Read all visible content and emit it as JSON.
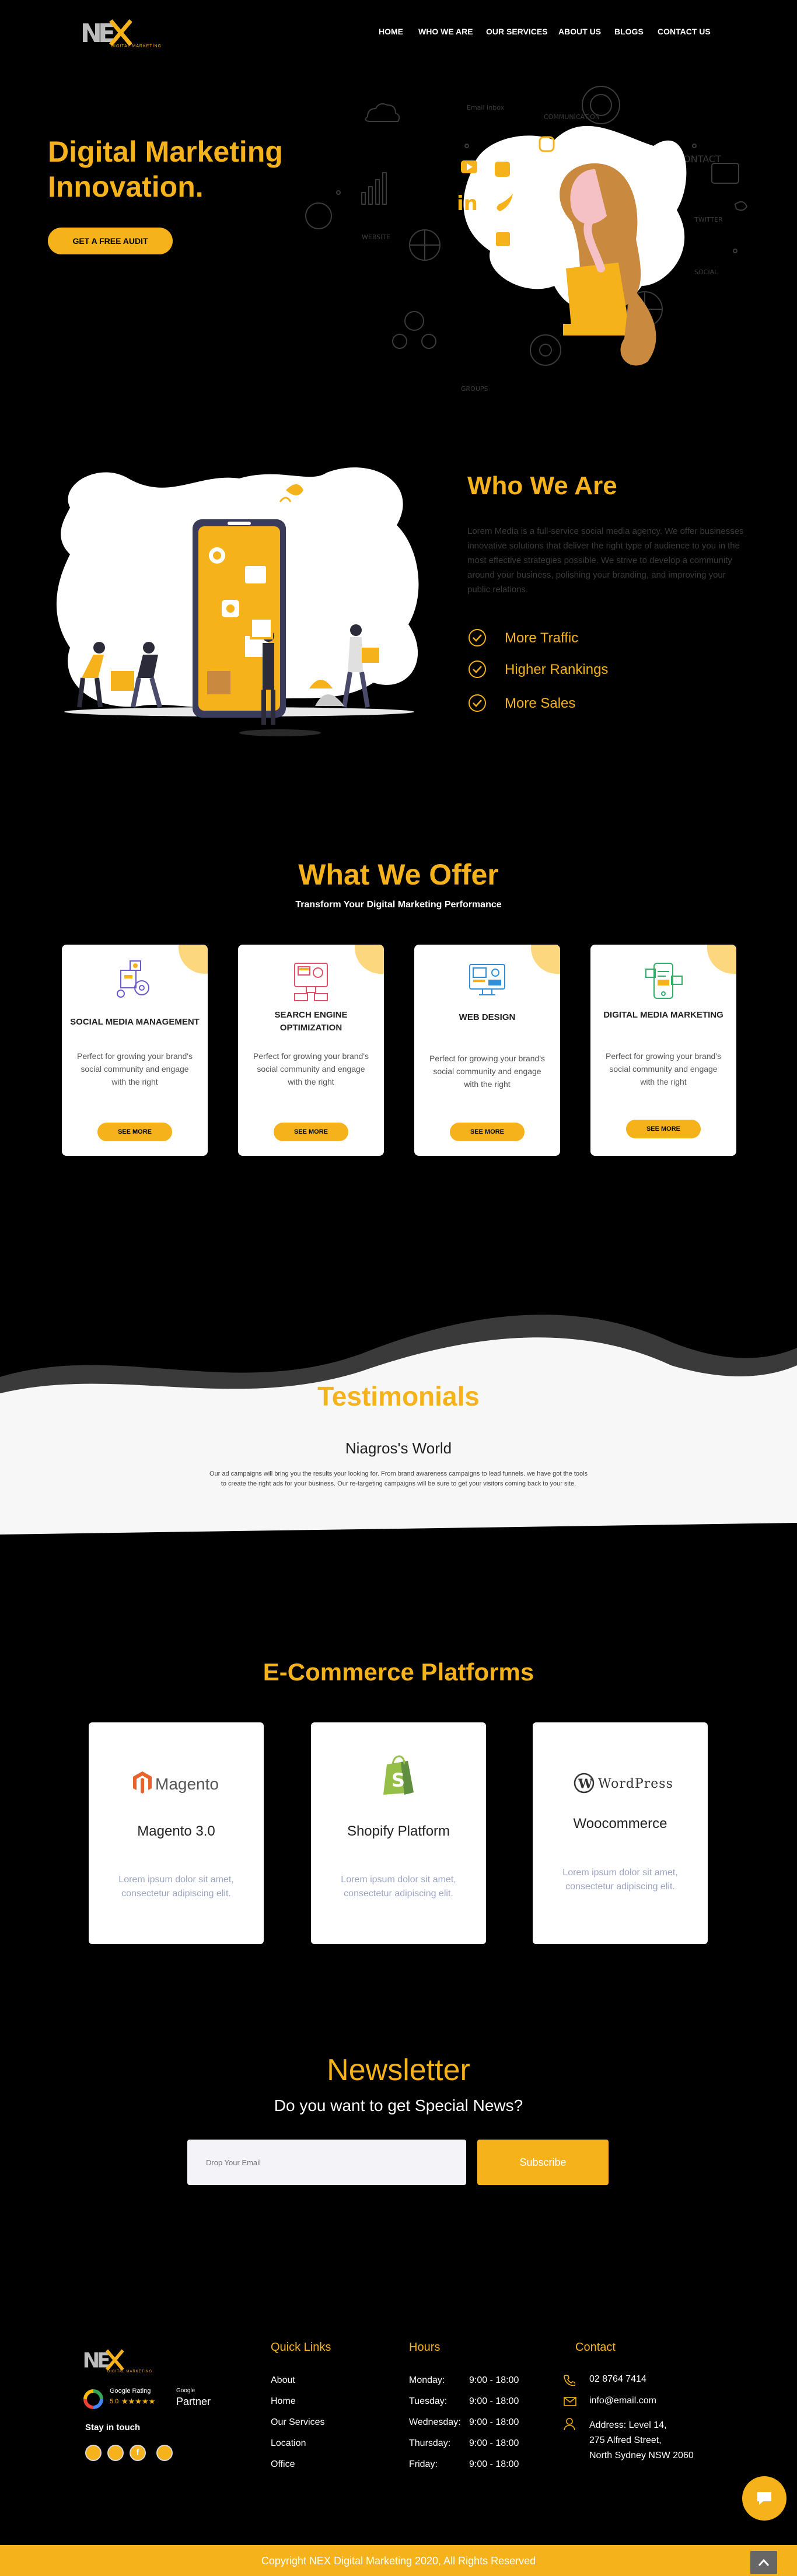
{
  "brand": {
    "logo_text": "NEX",
    "logo_sub": "DIGITAL MARKETING"
  },
  "nav": {
    "items": [
      {
        "label": "HOME"
      },
      {
        "label": "WHO WE ARE"
      },
      {
        "label": "OUR SERVICES"
      },
      {
        "label": "ABOUT US"
      },
      {
        "label": "BLOGS"
      },
      {
        "label": "CONTACT US"
      }
    ]
  },
  "hero": {
    "title_line1": "Digital Marketing",
    "title_line2": "Innovation.",
    "cta": "GET A FREE AUDIT",
    "doodle_words": [
      "Email Inbox",
      "COMMUNICATION",
      "CONTACT",
      "TWITTER",
      "WEBSITE",
      "SOCIAL",
      "GROUPS"
    ]
  },
  "who": {
    "title": "Who We Are",
    "body": "Lorem Media is a full-service social media agency. We offer businesses innovative solutions that deliver the right type of audience to you in the most effective strategies possible. We strive to develop a community around your business, polishing your branding, and improving your public relations.",
    "points": [
      "More Traffic",
      "Higher Rankings",
      "More Sales"
    ]
  },
  "offer": {
    "title": "What We Offer",
    "subtitle": "Transform Your Digital Marketing Performance",
    "cards": [
      {
        "title": "SOCIAL MEDIA MANAGEMENT",
        "text": "Perfect for growing your brand's social community and engage with the right",
        "button": "SEE MORE",
        "icon": "social-media-icon"
      },
      {
        "title": "SEARCH ENGINE OPTIMIZATION",
        "text": "Perfect for growing your brand's social community and engage with the right",
        "button": "SEE MORE",
        "icon": "seo-icon"
      },
      {
        "title": "WEB DESIGN",
        "text": "Perfect for growing your brand's social community and engage with the right",
        "button": "SEE MORE",
        "icon": "web-design-icon"
      },
      {
        "title": "DIGITAL MEDIA MARKETING",
        "text": "Perfect for growing your brand's social community and engage with the right",
        "button": "SEE MORE",
        "icon": "digital-marketing-icon"
      }
    ]
  },
  "testimonials": {
    "title": "Testimonials",
    "name": "Niagros's World",
    "quote_line1": "Our ad campaigns will bring you the results your looking for. From brand awareness campaigns to lead funnels. we have got the tools",
    "quote_line2": "to create the right ads for your business. Our re-targeting campaigns will be sure to get your visitors coming back to your site."
  },
  "ecommerce": {
    "title": "E-Commerce Platforms",
    "cards": [
      {
        "logo": "Magento",
        "name": "Magento 3.0",
        "text": "Lorem ipsum dolor sit amet, consectetur adipiscing elit."
      },
      {
        "logo": "S",
        "name": "Shopify Platform",
        "text": "Lorem ipsum dolor sit amet, consectetur adipiscing elit."
      },
      {
        "logo": "WordPress",
        "name": "Woocommerce",
        "text": "Lorem ipsum dolor sit amet, consectetur adipiscing elit."
      }
    ]
  },
  "newsletter": {
    "title": "Newsletter",
    "subtitle": "Do you want to get Special News?",
    "placeholder": "Drop Your Email",
    "button": "Subscribe"
  },
  "footer": {
    "google": {
      "line1": "Google Rating",
      "rating": "5.0",
      "stars": "★★★★★",
      "badge_top": "Google",
      "badge_main": "Partner"
    },
    "stay": "Stay in touch",
    "quick_links": {
      "title": "Quick Links",
      "items": [
        "About",
        "Home",
        "Our Services",
        "Location",
        "Office"
      ]
    },
    "hours": {
      "title": "Hours",
      "rows": [
        {
          "day": "Monday:",
          "time": "9:00 - 18:00"
        },
        {
          "day": "Tuesday:",
          "time": "9:00 - 18:00"
        },
        {
          "day": "Wednesday:",
          "time": "9:00 - 18:00"
        },
        {
          "day": "Thursday:",
          "time": "9:00 - 18:00"
        },
        {
          "day": "Friday:",
          "time": "9:00 - 18:00"
        }
      ]
    },
    "contact": {
      "title": "Contact",
      "phone": "02 8764 7414",
      "email": "info@email.com",
      "address_line1": "Address: Level 14,",
      "address_line2": "275 Alfred Street,",
      "address_line3": "North Sydney NSW 2060"
    },
    "copyright": "Copyright NEX Digital Marketing 2020, All Rights Reserved"
  },
  "colors": {
    "accent": "#f5b21a",
    "background": "#000000",
    "card": "#ffffff",
    "light_section": "#f7f7f7"
  }
}
